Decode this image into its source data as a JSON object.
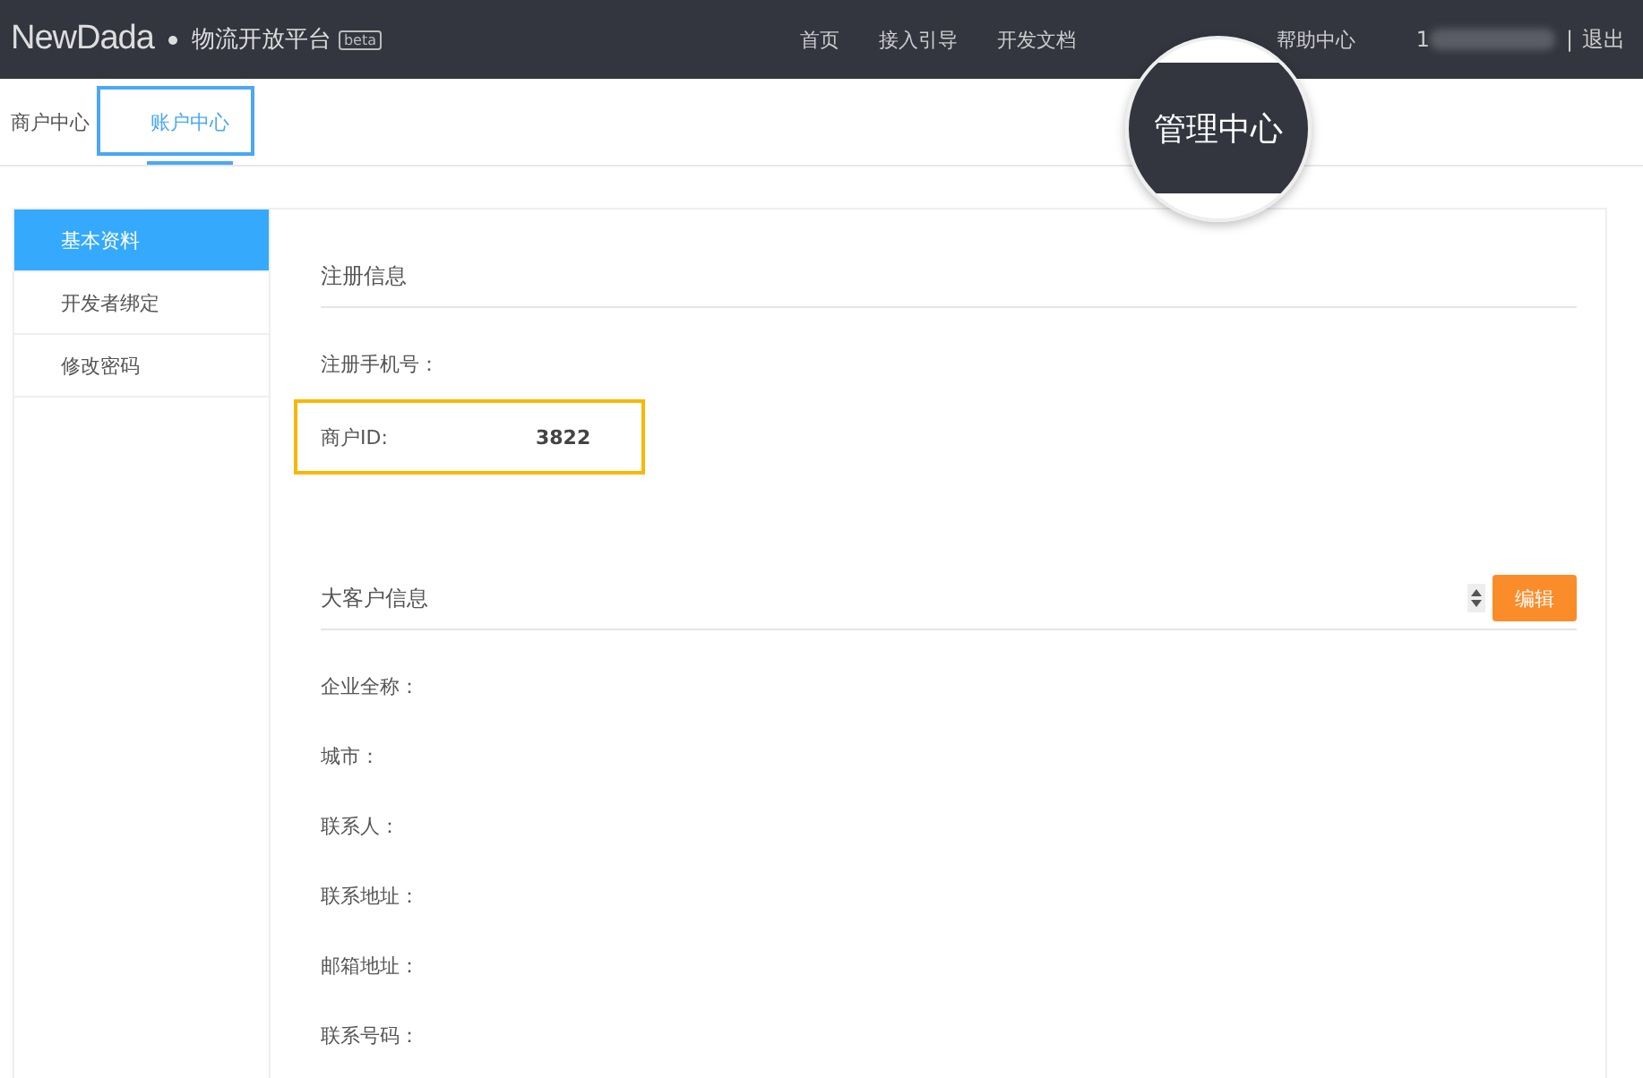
{
  "header": {
    "logo": "NewDada",
    "platform": "物流开放平台",
    "badge": "beta",
    "nav": [
      {
        "label": "首页"
      },
      {
        "label": "接入引导"
      },
      {
        "label": "开发文档"
      },
      {
        "label": "帮助中心"
      }
    ],
    "user": "1",
    "separator": "|",
    "logout": "退出"
  },
  "magnifier": {
    "text": "管理中心"
  },
  "tabs": [
    {
      "label": "商户中心",
      "selected": false
    },
    {
      "label": "账户中心",
      "selected": true,
      "highlighted": true
    }
  ],
  "sidebar": {
    "items": [
      {
        "label": "基本资料",
        "selected": true
      },
      {
        "label": "开发者绑定",
        "selected": false
      },
      {
        "label": "修改密码",
        "selected": false
      }
    ]
  },
  "sections": [
    {
      "title": "注册信息",
      "fields": [
        {
          "label": "注册手机号：",
          "highlighted": false
        },
        {
          "label": "商户ID:",
          "value": "3822",
          "highlighted": true
        }
      ]
    },
    {
      "title": "大客户信息",
      "button": "编辑",
      "fields": [
        {
          "label": "企业全称："
        },
        {
          "label": "城市："
        },
        {
          "label": "联系人："
        },
        {
          "label": "联系地址："
        },
        {
          "label": "邮箱地址："
        },
        {
          "label": "联系号码："
        }
      ]
    }
  ]
}
